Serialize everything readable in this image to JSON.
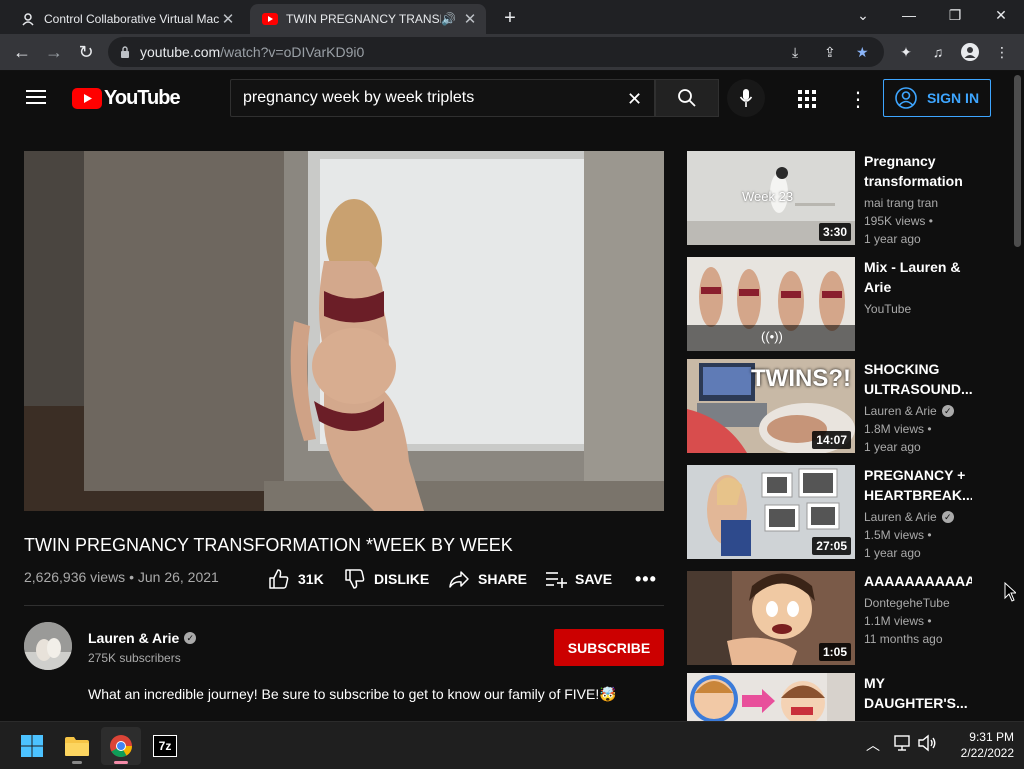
{
  "browser": {
    "tabs": [
      {
        "title": "Control Collaborative Virtual Mac",
        "active": false
      },
      {
        "title": "TWIN PREGNANCY TRANSFO",
        "active": true
      }
    ],
    "address": {
      "host": "youtube.com",
      "path": "/watch?v=oDIVarKD9i0"
    }
  },
  "masthead": {
    "logo_text": "YouTube",
    "search_value": "pregnancy week by week triplets",
    "signin_label": "SIGN IN"
  },
  "video": {
    "title": "TWIN PREGNANCY TRANSFORMATION *WEEK BY WEEK",
    "views_date": "2,626,936 views • Jun 26, 2021",
    "like_count": "31K",
    "dislike_label": "DISLIKE",
    "share_label": "SHARE",
    "save_label": "SAVE",
    "channel": {
      "name": "Lauren & Arie",
      "subscribers": "275K subscribers"
    },
    "subscribe_label": "SUBSCRIBE",
    "description": "What an incredible journey! Be sure to subscribe to get to know our family of FIVE!🤯"
  },
  "recommendations": [
    {
      "title": "Pregnancy transformation",
      "channel": "mai trang tran",
      "verified": false,
      "views": "195K views •",
      "age": "1 year ago",
      "duration": "3:30",
      "thumb_text": "Week 23"
    },
    {
      "title": "Mix - Lauren & Arie",
      "channel": "YouTube",
      "verified": false,
      "views": "",
      "age": "",
      "duration": "",
      "thumb_text": ""
    },
    {
      "title": "SHOCKING ULTRASOUND...",
      "channel": "Lauren & Arie",
      "verified": true,
      "views": "1.8M views •",
      "age": "1 year ago",
      "duration": "14:07",
      "thumb_text": "TWINS?!"
    },
    {
      "title": "PREGNANCY + HEARTBREAK...",
      "channel": "Lauren & Arie",
      "verified": true,
      "views": "1.5M views •",
      "age": "1 year ago",
      "duration": "27:05",
      "thumb_text": ""
    },
    {
      "title": "AAAAAAAAAAA",
      "channel": "DontegeheTube",
      "verified": false,
      "views": "1.1M views •",
      "age": "11 months ago",
      "duration": "1:05",
      "thumb_text": ""
    },
    {
      "title": "MY DAUGHTER'S...",
      "channel": "",
      "verified": false,
      "views": "",
      "age": "",
      "duration": "",
      "thumb_text": ""
    }
  ],
  "taskbar": {
    "time": "9:31 PM",
    "date": "2/22/2022",
    "apps": [
      "windows-start",
      "file-explorer",
      "chrome",
      "7-zip"
    ],
    "sevenzip_label": "7z"
  }
}
